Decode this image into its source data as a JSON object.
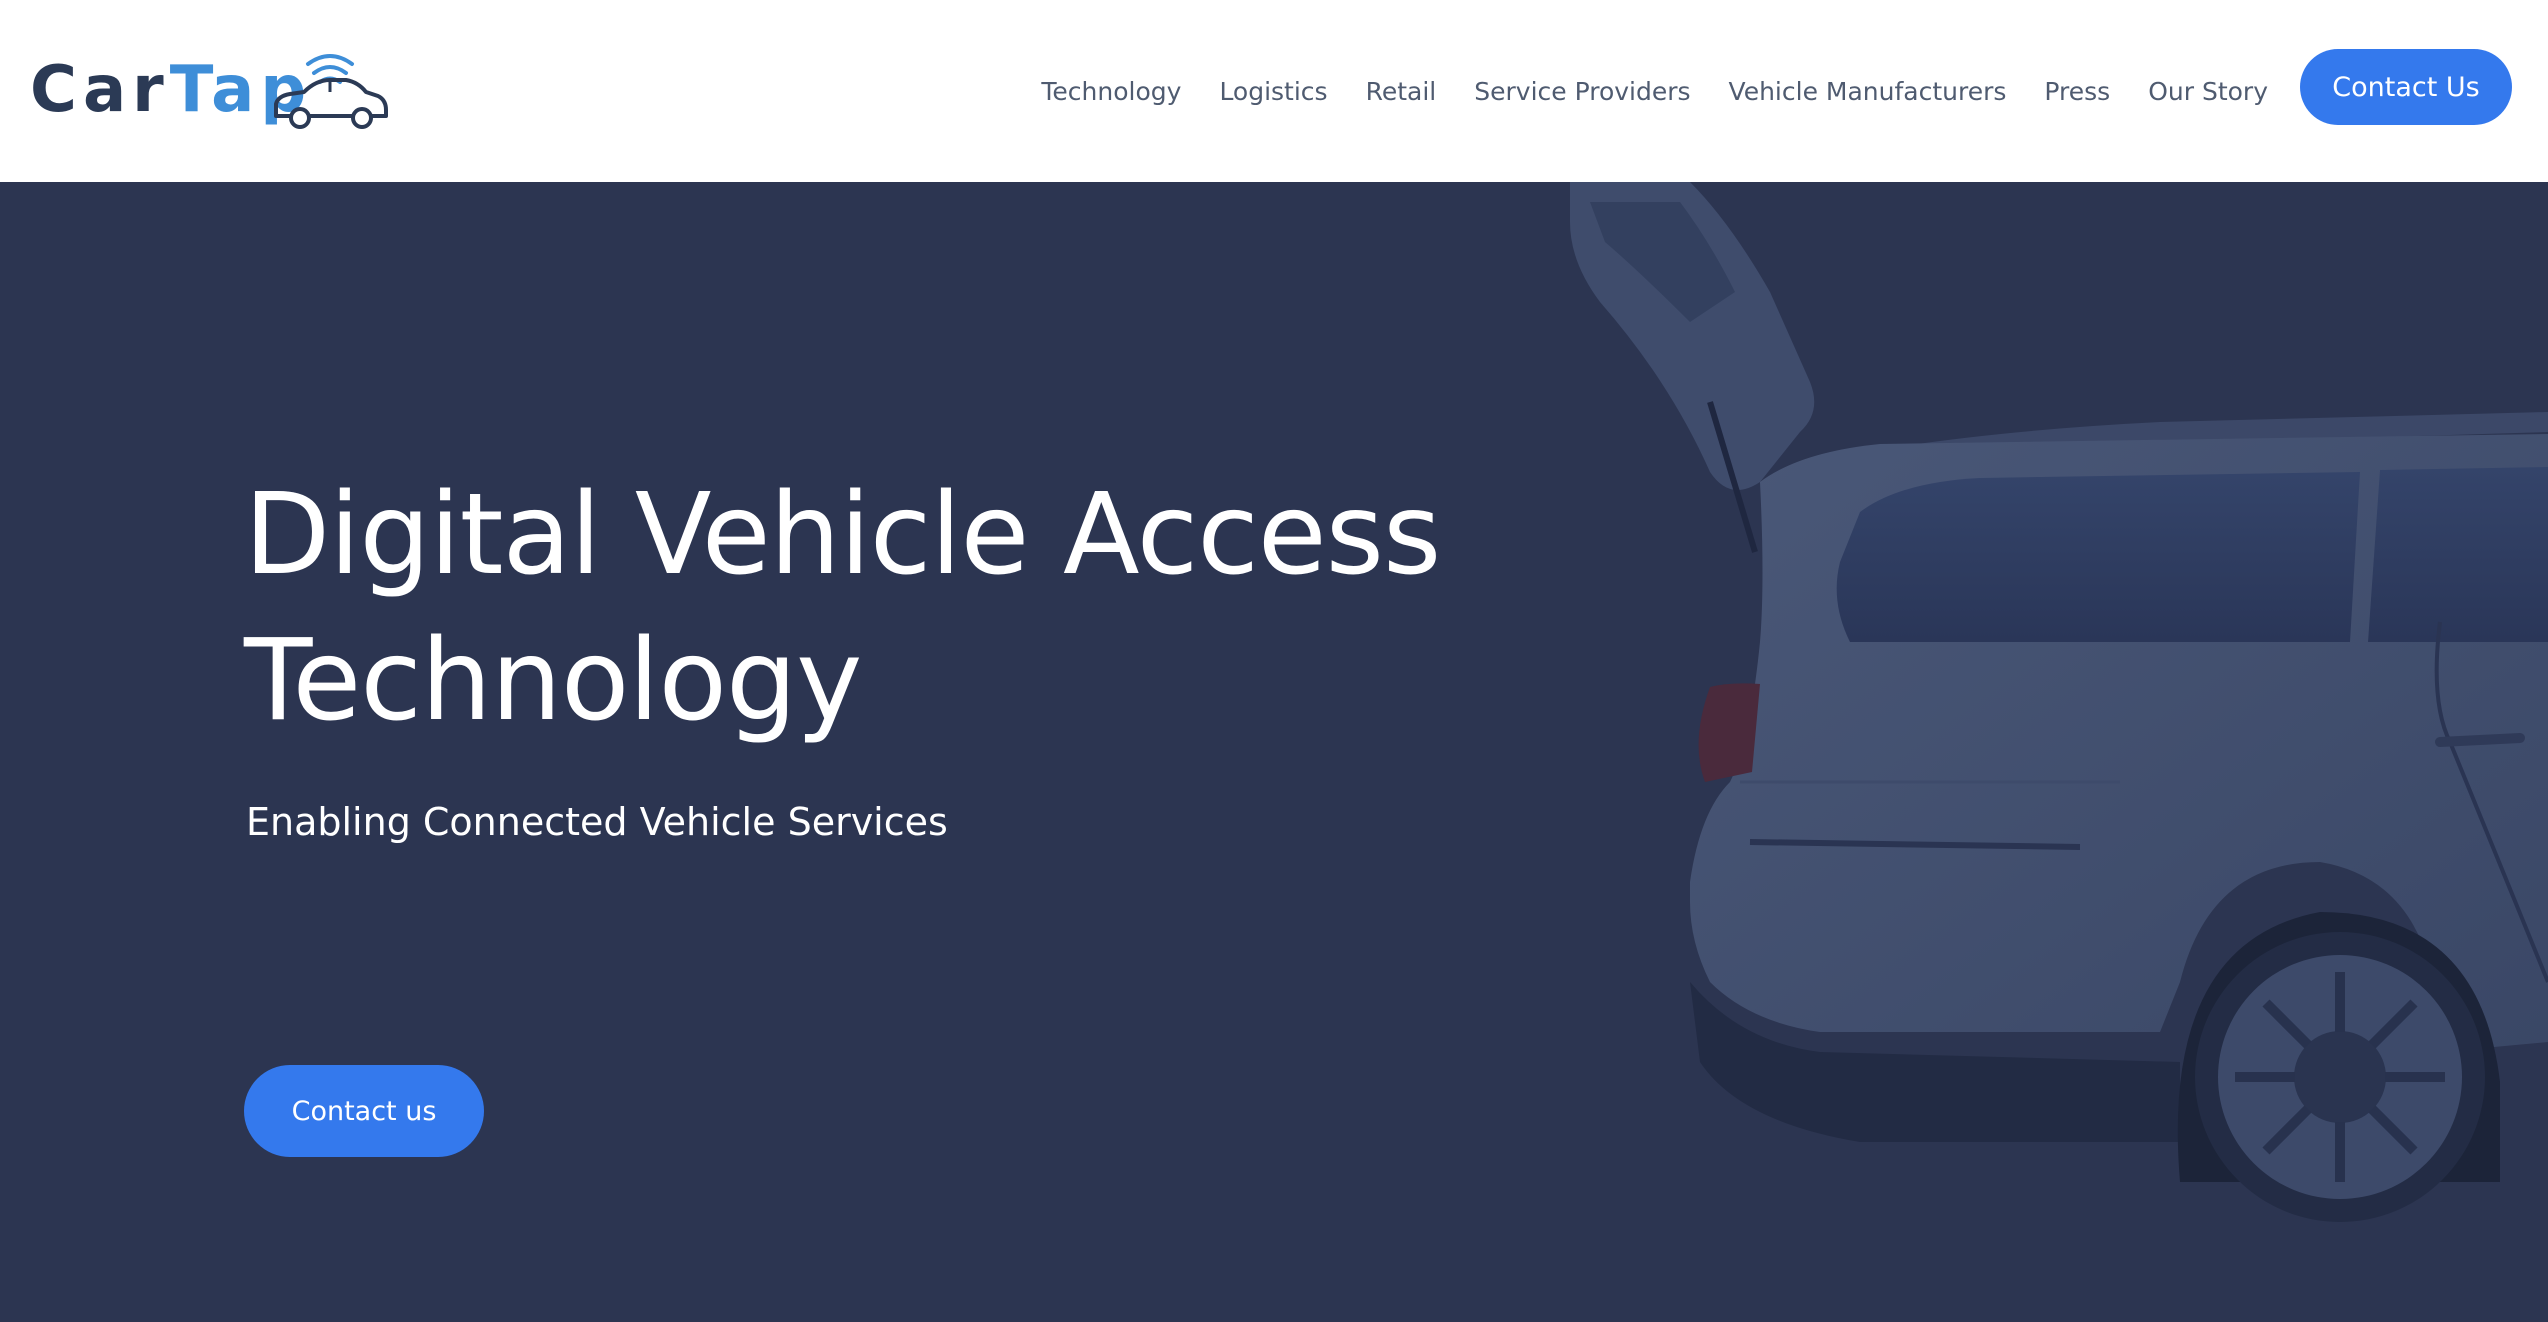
{
  "brand": {
    "name_part1": "Car",
    "name_part2": "Tap",
    "colors": {
      "dark": "#2b3a55",
      "accent": "#3e8ed8"
    },
    "icon": "connected-car-icon"
  },
  "nav": {
    "items": [
      {
        "label": "Technology"
      },
      {
        "label": "Logistics"
      },
      {
        "label": "Retail"
      },
      {
        "label": "Service Providers"
      },
      {
        "label": "Vehicle Manufacturers"
      },
      {
        "label": "Press"
      },
      {
        "label": "Our Story"
      }
    ],
    "cta_label": "Contact Us"
  },
  "hero": {
    "title": "Digital Vehicle Access Technology",
    "subtitle": "Enabling Connected Vehicle Services",
    "cta_label": "Contact us",
    "background_color": "#2c3551",
    "image": "car-open-trunk-image"
  },
  "colors": {
    "button_blue": "#3479ed",
    "nav_text": "#4f5b70"
  }
}
